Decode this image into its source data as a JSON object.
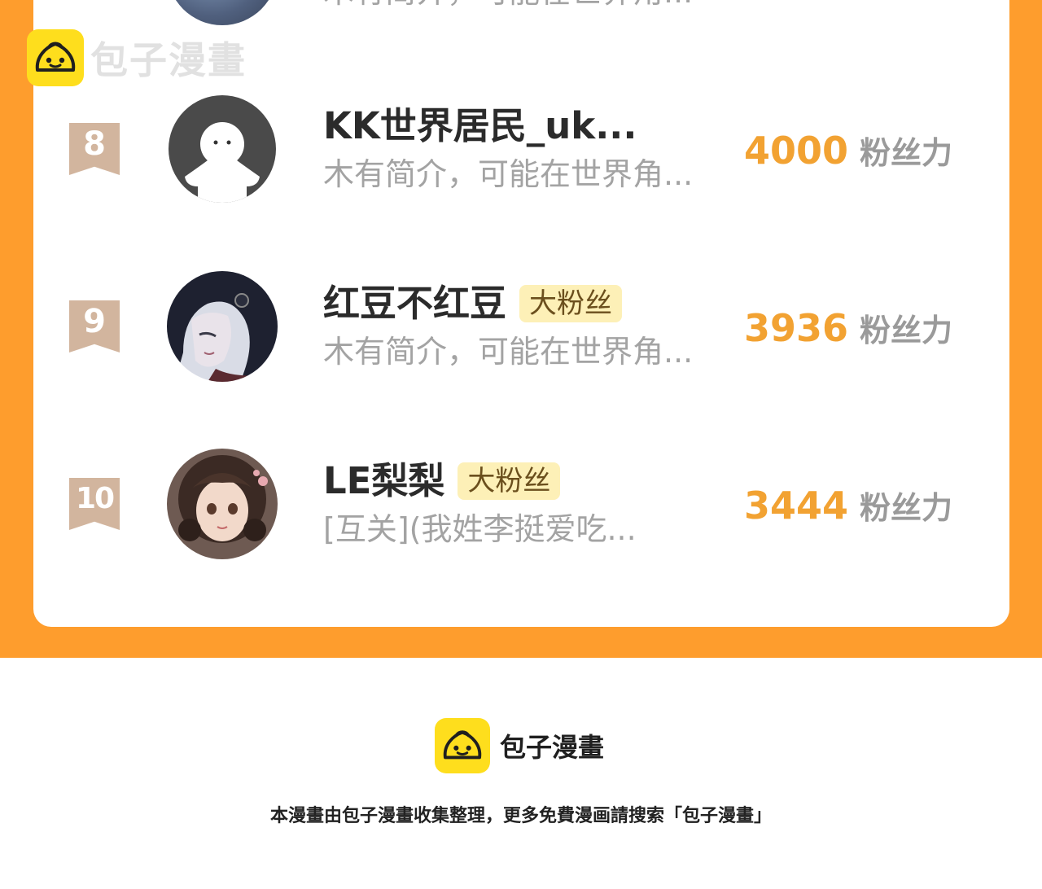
{
  "watermark": {
    "brand": "包子漫畫"
  },
  "top_row": {
    "bio": "木有简介，可能在世界角..."
  },
  "ranking": [
    {
      "rank": "8",
      "name": "KK世界居民_uk...",
      "badge": "",
      "bio": "木有简介，可能在世界角...",
      "score": "4000",
      "score_unit": "粉丝力",
      "avatar_icon": "default-ghost-avatar"
    },
    {
      "rank": "9",
      "name": "红豆不红豆",
      "badge": "大粉丝",
      "bio": "木有简介，可能在世界角...",
      "score": "3936",
      "score_unit": "粉丝力",
      "avatar_icon": "anime-dark-hair-avatar"
    },
    {
      "rank": "10",
      "name": "LE梨梨",
      "badge": "大粉丝",
      "bio": "[互关](我姓李挺爱吃...",
      "score": "3444",
      "score_unit": "粉丝力",
      "avatar_icon": "anime-curly-hair-avatar"
    }
  ],
  "footer": {
    "brand": "包子漫畫",
    "notice": "本漫畫由包子漫畫收集整理，更多免費漫画請搜索「包子漫畫」"
  },
  "colors": {
    "frame": "#fe9d2d",
    "score": "#f2a232",
    "rank_ribbon": "#d2b59e",
    "badge_bg": "#fdf0b7",
    "logo_yellow": "#fede1d"
  }
}
